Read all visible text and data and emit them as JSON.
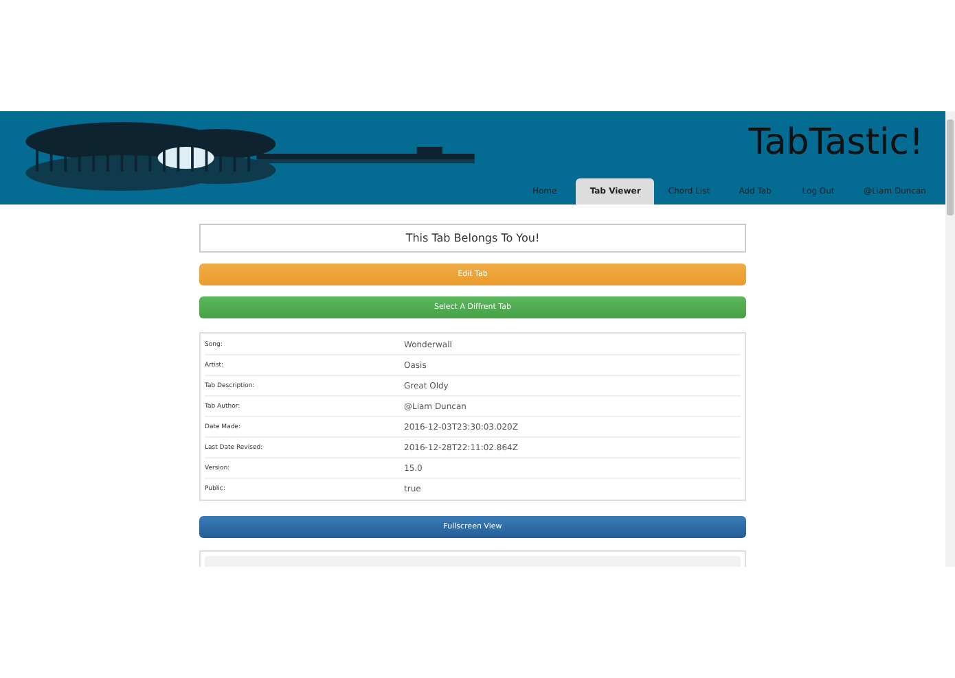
{
  "site_title": "TabTastic!",
  "nav": [
    {
      "label": "Home",
      "selected": false
    },
    {
      "label": "Tab Viewer",
      "selected": true
    },
    {
      "label": "Chord List",
      "selected": false
    },
    {
      "label": "Add Tab",
      "selected": false
    },
    {
      "label": "Log Out",
      "selected": false
    },
    {
      "label": "@Liam Duncan",
      "selected": false
    }
  ],
  "ownership_notice": "This Tab Belongs To You!",
  "buttons": [
    {
      "label": "Edit Tab",
      "kind": "warning"
    },
    {
      "label": "Select A Diffrent Tab",
      "kind": "success"
    }
  ],
  "details": [
    {
      "label": "Song:",
      "value": "Wonderwall"
    },
    {
      "label": "Artist:",
      "value": "Oasis"
    },
    {
      "label": "Tab Description:",
      "value": "Great Oldy"
    },
    {
      "label": "Tab Author:",
      "value": "@Liam Duncan"
    },
    {
      "label": "Date Made:",
      "value": "2016-12-03T23:30:03.020Z"
    },
    {
      "label": "Last Date Revised:",
      "value": "2016-12-28T22:11:02.864Z"
    },
    {
      "label": "Version:",
      "value": "15.0"
    },
    {
      "label": "Public:",
      "value": "true"
    }
  ],
  "fullscreen_button": "Fullscreen View"
}
